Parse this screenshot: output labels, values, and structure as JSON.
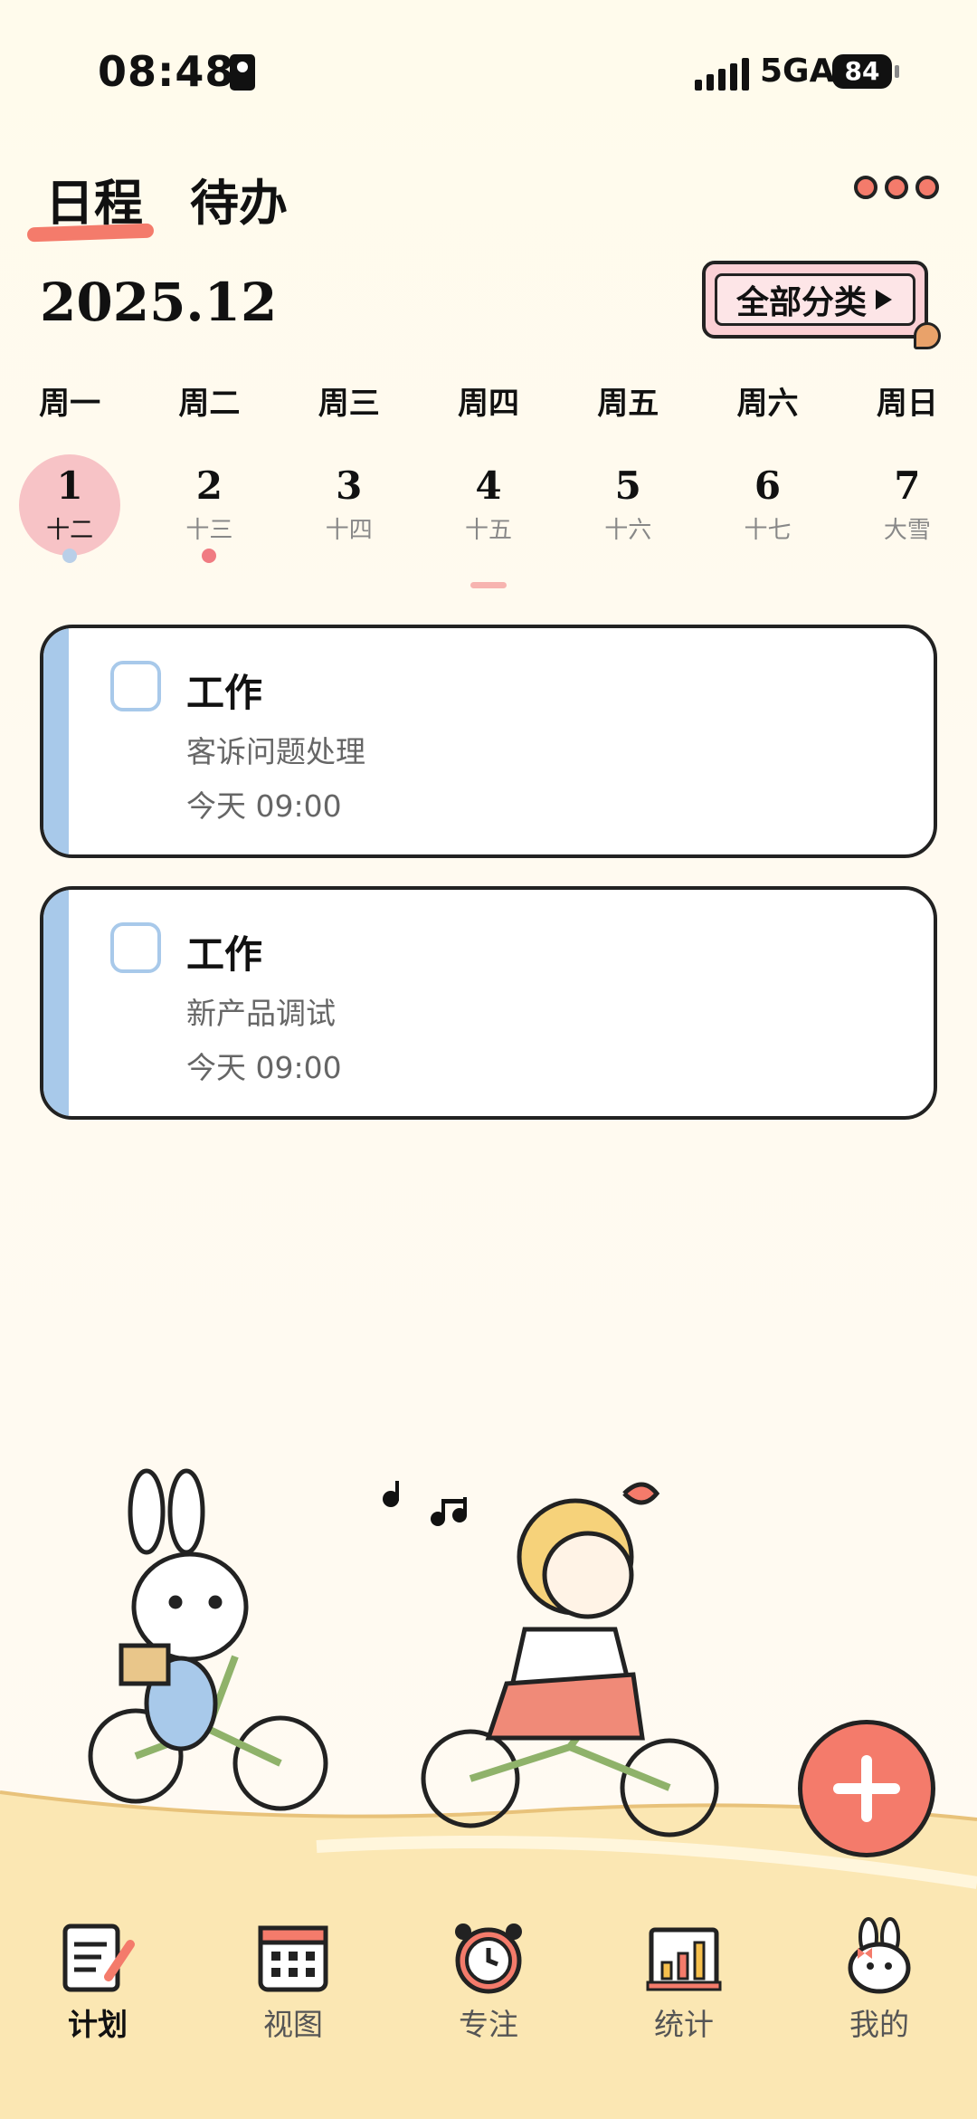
{
  "status_bar": {
    "time": "08:48",
    "network": "5GA",
    "battery": "84"
  },
  "header": {
    "tabs": [
      {
        "label": "日程",
        "active": true
      },
      {
        "label": "待办",
        "active": false
      }
    ],
    "more_icon": "three-dots-icon"
  },
  "month_label": "2025.12",
  "category_button": {
    "label": "全部分类"
  },
  "week": {
    "weekdays": [
      "周一",
      "周二",
      "周三",
      "周四",
      "周五",
      "周六",
      "周日"
    ],
    "days": [
      {
        "num": "1",
        "lunar": "十二",
        "selected": true,
        "dot": "#b9cfe8"
      },
      {
        "num": "2",
        "lunar": "十三",
        "selected": false,
        "dot": "#f07b82"
      },
      {
        "num": "3",
        "lunar": "十四",
        "selected": false
      },
      {
        "num": "4",
        "lunar": "十五",
        "selected": false
      },
      {
        "num": "5",
        "lunar": "十六",
        "selected": false
      },
      {
        "num": "6",
        "lunar": "十七",
        "selected": false
      },
      {
        "num": "7",
        "lunar": "大雪",
        "selected": false
      }
    ]
  },
  "tasks": [
    {
      "category": "工作",
      "title": "客诉问题处理",
      "time": "今天 09:00",
      "color": "#a8c9ea"
    },
    {
      "category": "工作",
      "title": "新产品调试",
      "time": "今天 09:00",
      "color": "#a8c9ea"
    }
  ],
  "fab": {
    "icon": "plus-icon",
    "color": "#f47b6b"
  },
  "bottom_nav": [
    {
      "label": "计划",
      "icon": "plan-notepad-icon",
      "active": true
    },
    {
      "label": "视图",
      "icon": "calendar-icon",
      "active": false
    },
    {
      "label": "专注",
      "icon": "alarm-clock-icon",
      "active": false
    },
    {
      "label": "统计",
      "icon": "bar-chart-icon",
      "active": false
    },
    {
      "label": "我的",
      "icon": "bunny-profile-icon",
      "active": false
    }
  ],
  "colors": {
    "accent": "#f47b6b",
    "background": "#fffbec",
    "task_stripe": "#a8c9ea",
    "selected_day": "#f7c3c6"
  }
}
